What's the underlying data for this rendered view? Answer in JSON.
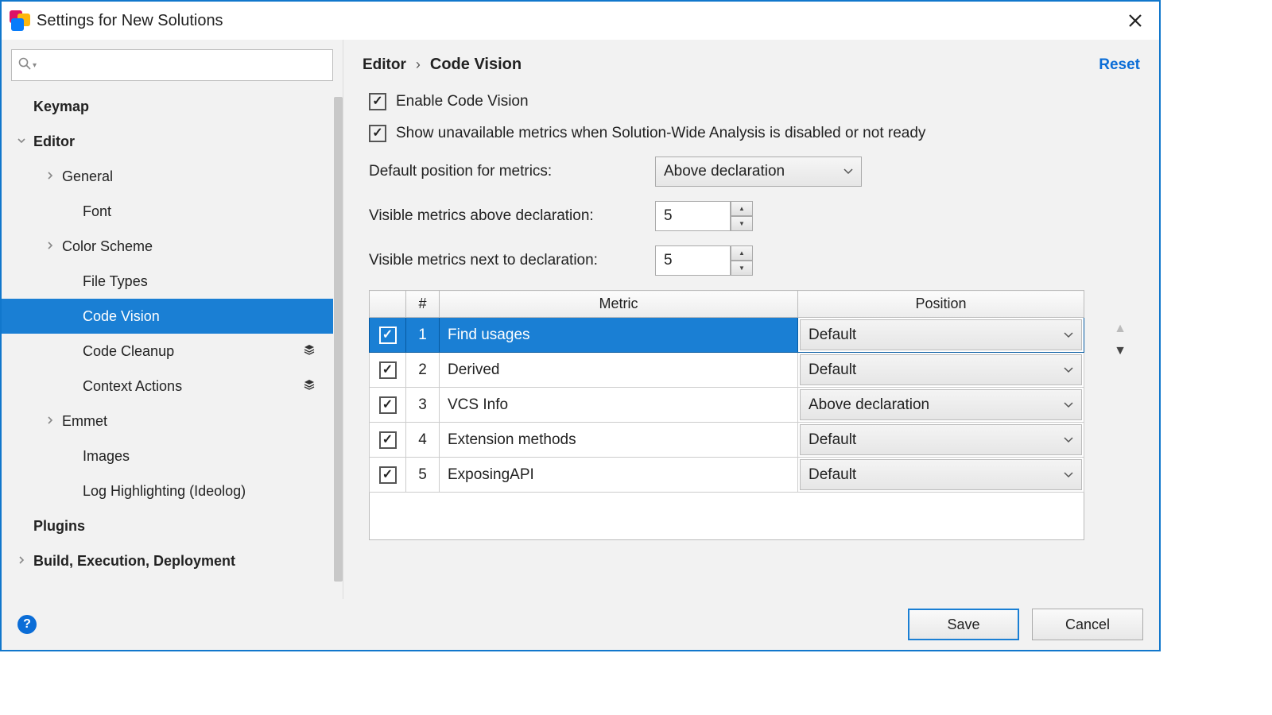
{
  "window": {
    "title": "Settings for New Solutions"
  },
  "search": {
    "placeholder": ""
  },
  "sidebar": {
    "items": [
      {
        "label": "Keymap",
        "bold": true,
        "level": 0,
        "chev": ""
      },
      {
        "label": "Editor",
        "bold": true,
        "level": 0,
        "chev": "v"
      },
      {
        "label": "General",
        "level": 1,
        "chev": ">"
      },
      {
        "label": "Font",
        "level": 2,
        "chev": ""
      },
      {
        "label": "Color Scheme",
        "level": 1,
        "chev": ">"
      },
      {
        "label": "File Types",
        "level": 2,
        "chev": ""
      },
      {
        "label": "Code Vision",
        "level": 2,
        "chev": "",
        "selected": true
      },
      {
        "label": "Code Cleanup",
        "level": 2,
        "chev": "",
        "layers": true
      },
      {
        "label": "Context Actions",
        "level": 2,
        "chev": "",
        "layers": true
      },
      {
        "label": "Emmet",
        "level": 1,
        "chev": ">"
      },
      {
        "label": "Images",
        "level": 2,
        "chev": ""
      },
      {
        "label": "Log Highlighting (Ideolog)",
        "level": 2,
        "chev": ""
      },
      {
        "label": "Plugins",
        "bold": true,
        "level": 0,
        "chev": ""
      },
      {
        "label": "Build, Execution, Deployment",
        "bold": true,
        "level": 0,
        "chev": ">"
      }
    ]
  },
  "breadcrumb": {
    "parent": "Editor",
    "current": "Code Vision",
    "reset": "Reset"
  },
  "options": {
    "enable_label": "Enable Code Vision",
    "show_unavailable_label": "Show unavailable metrics when Solution-Wide Analysis is disabled or not ready",
    "default_position_label": "Default position for metrics:",
    "default_position_value": "Above declaration",
    "visible_above_label": "Visible metrics above declaration:",
    "visible_above_value": "5",
    "visible_next_label": "Visible metrics next to declaration:",
    "visible_next_value": "5"
  },
  "table": {
    "headers": {
      "num": "#",
      "metric": "Metric",
      "position": "Position"
    },
    "rows": [
      {
        "enabled": true,
        "num": "1",
        "metric": "Find usages",
        "position": "Default",
        "selected": true
      },
      {
        "enabled": true,
        "num": "2",
        "metric": "Derived",
        "position": "Default"
      },
      {
        "enabled": true,
        "num": "3",
        "metric": "VCS Info",
        "position": "Above declaration"
      },
      {
        "enabled": true,
        "num": "4",
        "metric": "Extension methods",
        "position": "Default"
      },
      {
        "enabled": true,
        "num": "5",
        "metric": "ExposingAPI",
        "position": "Default"
      }
    ]
  },
  "buttons": {
    "save": "Save",
    "cancel": "Cancel"
  }
}
